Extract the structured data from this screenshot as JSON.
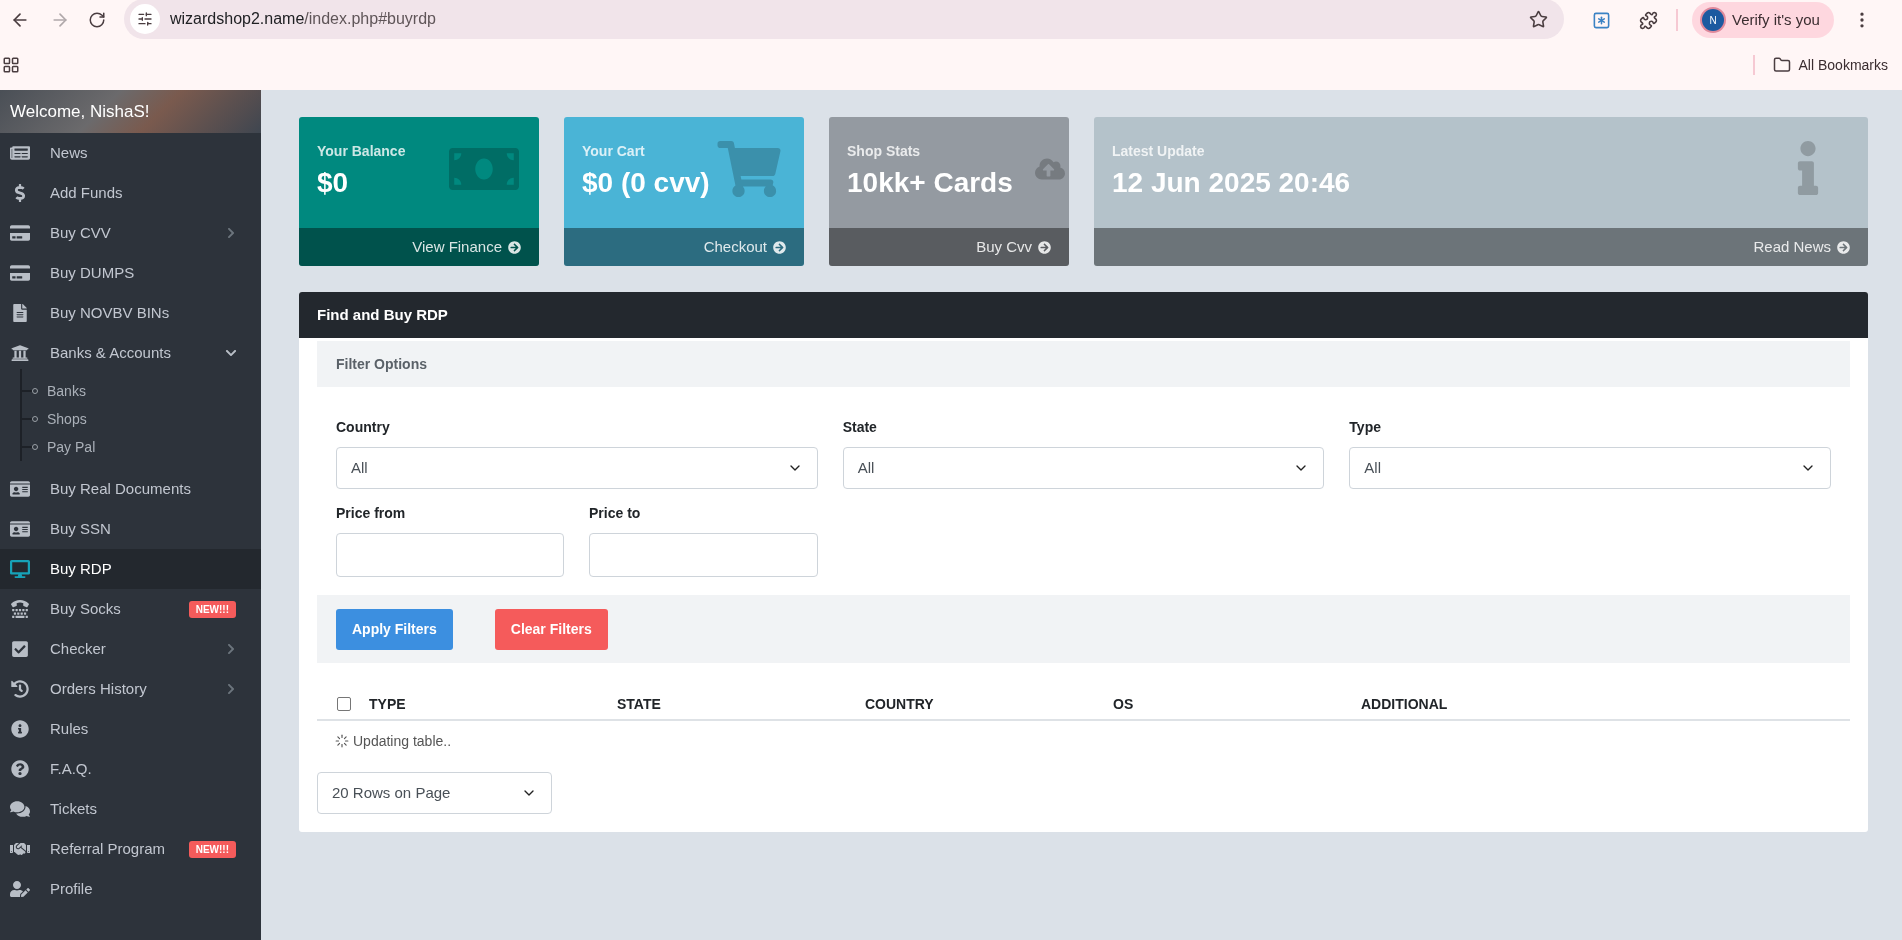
{
  "browser": {
    "url_host": "wizardshop2.name",
    "url_path": "/index.php#buyrdp",
    "forward": {
      "disabled": true
    },
    "profile": {
      "initial": "N",
      "label": "Verify it's you"
    },
    "bookmarks": {
      "label": "All Bookmarks"
    }
  },
  "sidebar": {
    "welcome": "Welcome, NishaS!",
    "items": [
      {
        "label": "News",
        "selected": false
      },
      {
        "label": "Add Funds",
        "selected": false
      },
      {
        "label": "Buy CVV",
        "selected": false,
        "expanded": false
      },
      {
        "label": "Buy DUMPS",
        "selected": false
      },
      {
        "label": "Buy NOVBV BINs",
        "selected": false
      },
      {
        "label": "Banks & Accounts",
        "selected": false,
        "expanded": true,
        "children": [
          {
            "label": "Banks"
          },
          {
            "label": "Shops"
          },
          {
            "label": "Pay Pal"
          }
        ]
      },
      {
        "label": "Buy Real Documents",
        "selected": false
      },
      {
        "label": "Buy SSN",
        "selected": false
      },
      {
        "label": "Buy RDP",
        "selected": true
      },
      {
        "label": "Buy Socks",
        "selected": false,
        "badge": "NEW!!!"
      },
      {
        "label": "Checker",
        "selected": false,
        "expanded": false
      },
      {
        "label": "Orders History",
        "selected": false,
        "expanded": false
      },
      {
        "label": "Rules",
        "selected": false
      },
      {
        "label": "F.A.Q.",
        "selected": false
      },
      {
        "label": "Tickets",
        "selected": false
      },
      {
        "label": "Referral Program",
        "selected": false,
        "badge": "NEW!!!"
      },
      {
        "label": "Profile",
        "selected": false
      }
    ]
  },
  "cards": [
    {
      "title": "Your Balance",
      "value": "$0",
      "link": "View Finance",
      "color": "#00897f"
    },
    {
      "title": "Your Cart",
      "value": "$0 (0 cvv)",
      "link": "Checkout",
      "color": "#4ab4d6"
    },
    {
      "title": "Shop Stats",
      "value": "10kk+ Cards",
      "link": "Buy Cvv",
      "color": "#949aa1"
    },
    {
      "title": "Latest Update",
      "value": "12 Jun 2025 20:46",
      "link": "Read News",
      "color": "#b4c2ca"
    }
  ],
  "panel": {
    "title": "Find and Buy RDP",
    "filter_title": "Filter Options",
    "fields": [
      {
        "kind": "select",
        "label": "Country",
        "value": "All"
      },
      {
        "kind": "select",
        "label": "State",
        "value": "All"
      },
      {
        "kind": "select",
        "label": "Type",
        "value": "All"
      },
      {
        "kind": "input",
        "label": "Price from"
      },
      {
        "kind": "input",
        "label": "Price to"
      }
    ],
    "buttons": [
      {
        "kind": "primary",
        "label": "Apply Filters"
      },
      {
        "kind": "danger",
        "label": "Clear Filters"
      }
    ],
    "table": {
      "select_all": {
        "checked": false
      },
      "columns": [
        "TYPE",
        "STATE",
        "COUNTRY",
        "OS",
        "ADDITIONAL"
      ],
      "status": "Updating table.."
    },
    "page_size": "20 Rows on Page"
  }
}
